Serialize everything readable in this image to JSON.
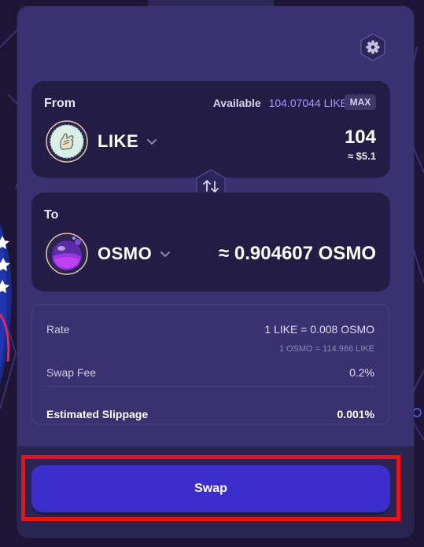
{
  "from": {
    "label": "From",
    "available_label": "Available",
    "available_amount": "104.07044 LIKE",
    "max_label": "MAX",
    "token_symbol": "LIKE",
    "amount": "104",
    "usd_value": "≈ $5.1"
  },
  "to": {
    "label": "To",
    "token_symbol": "OSMO",
    "estimated_amount": "≈ 0.904607 OSMO"
  },
  "details": {
    "rate_label": "Rate",
    "rate_value": "1 LIKE = 0.008 OSMO",
    "rate_inverse": "1 OSMO = 114.966 LIKE",
    "fee_label": "Swap Fee",
    "fee_value": "0.2%",
    "slippage_label": "Estimated Slippage",
    "slippage_value": "0.001%"
  },
  "swap_button_label": "Swap",
  "icons": {
    "settings": "gear-icon",
    "switch": "swap-arrows-icon",
    "like_token": "like-coin-icon",
    "osmo_token": "osmo-coin-icon",
    "dropdown": "chevron-down-icon"
  },
  "colors": {
    "accent": "#a498ff",
    "swap_button": "#3b2ecb",
    "highlight": "#ee1111"
  }
}
